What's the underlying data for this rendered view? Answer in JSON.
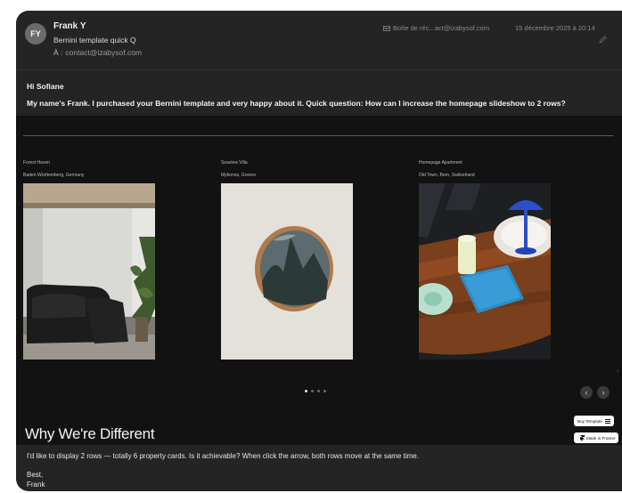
{
  "email": {
    "avatar_initials": "FY",
    "sender": "Frank Y",
    "subject": "Bernini template quick Q",
    "to_label": "À :",
    "to_address": "contact@izabysof.com",
    "mailbox": "Boîte de réc...act@izabysof.com",
    "date": "15 décembre 2025 à 20:14",
    "greeting": "Hi Sofiane",
    "message": "My name's Frank. I purchased your Bernini template and very happy about it. Quick question: How can I increase the homepage slideshow to 2 rows?",
    "followup": "I'd like to display 2 rows — totally 6 property cards. Is it achievable? When click the arrow, both rows move at the same time.",
    "signoff": "Best,",
    "signature": "Frank"
  },
  "embed": {
    "cards": [
      {
        "title": "Forest Haven",
        "location": "Baden-Württemberg, Germany",
        "image_icon": "living-room-photo"
      },
      {
        "title": "Seaview Villa",
        "location": "Mykonos, Greece",
        "image_icon": "round-mirror-photo"
      },
      {
        "title": "Homepage Apartment",
        "location": "Old Town, Bern, Switzerland",
        "image_icon": "table-lamp-photo"
      }
    ],
    "slideshow": {
      "total_dots": 4,
      "active_index": 0
    },
    "heading": "Why We're Different",
    "buy_button": "Buy Template",
    "framer_badge": "Made in Framer",
    "colors": {
      "background": "#121212",
      "pill": "#ffffff"
    }
  },
  "colors": {
    "window": "#242424",
    "text": "#f2f2f2",
    "muted": "#8a8a8a"
  }
}
